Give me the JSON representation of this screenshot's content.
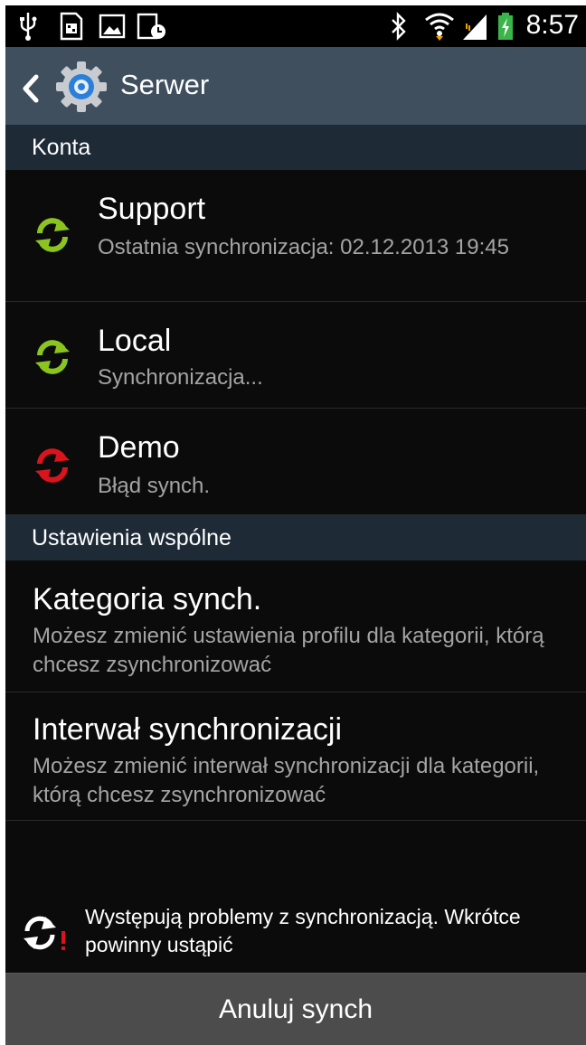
{
  "status_bar": {
    "time": "8:57",
    "icons": [
      "usb-icon",
      "sim-icon",
      "image-icon",
      "screenshot-icon",
      "bluetooth-icon",
      "wifi-icon",
      "signal-icon",
      "battery-charging-icon"
    ]
  },
  "action_bar": {
    "title": "Serwer",
    "back_icon": "chevron-left-icon",
    "app_icon": "gear-icon"
  },
  "accounts_section": {
    "header": "Konta",
    "items": [
      {
        "title": "Support",
        "subtitle": "Ostatnia synchronizacja: 02.12.2013 19:45",
        "status": "ok",
        "icon_color": "#8cc41f"
      },
      {
        "title": "Local",
        "subtitle": "Synchronizacja...",
        "status": "syncing",
        "icon_color": "#8cc41f"
      },
      {
        "title": "Demo",
        "subtitle": "Błąd synch.",
        "status": "error",
        "icon_color": "#d9141c"
      }
    ]
  },
  "common_section": {
    "header": "Ustawienia wspólne",
    "items": [
      {
        "title": "Kategoria synch.",
        "subtitle": "Możesz zmienić ustawienia profilu dla kategorii, którą chcesz zsynchronizować"
      },
      {
        "title": "Interwał synchronizacji",
        "subtitle": "Możesz zmienić interwał synchronizacji dla kategorii, którą chcesz zsynchronizować"
      }
    ]
  },
  "warning": {
    "text": "Występują problemy z synchronizacją. Wkrótce powinny ustąpić",
    "icon": "sync-warning-icon"
  },
  "bottom_button": {
    "label": "Anuluj synch"
  },
  "colors": {
    "action_bar": "#3f4f5e",
    "section_header": "#1e2b37",
    "background": "#0b0b0b",
    "sync_ok": "#8cc41f",
    "sync_error": "#d9141c",
    "bottom_button": "#4c4c4c"
  }
}
